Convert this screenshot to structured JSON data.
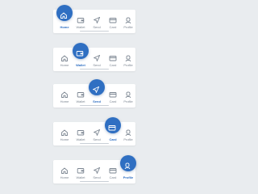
{
  "colors": {
    "accent": "#2f6fc2",
    "inactive": "#7b8591",
    "background": "#e9ecef",
    "bar": "#ffffff"
  },
  "nav_items": [
    {
      "label": "Home",
      "icon": "home-icon"
    },
    {
      "label": "Wallet",
      "icon": "wallet-icon"
    },
    {
      "label": "Send",
      "icon": "send-icon"
    },
    {
      "label": "Card",
      "icon": "card-icon"
    },
    {
      "label": "Profile",
      "icon": "profile-icon"
    }
  ],
  "variants": [
    {
      "active": "Home"
    },
    {
      "active": "Wallet"
    },
    {
      "active": "Send"
    },
    {
      "active": "Card"
    },
    {
      "active": "Profile"
    }
  ]
}
